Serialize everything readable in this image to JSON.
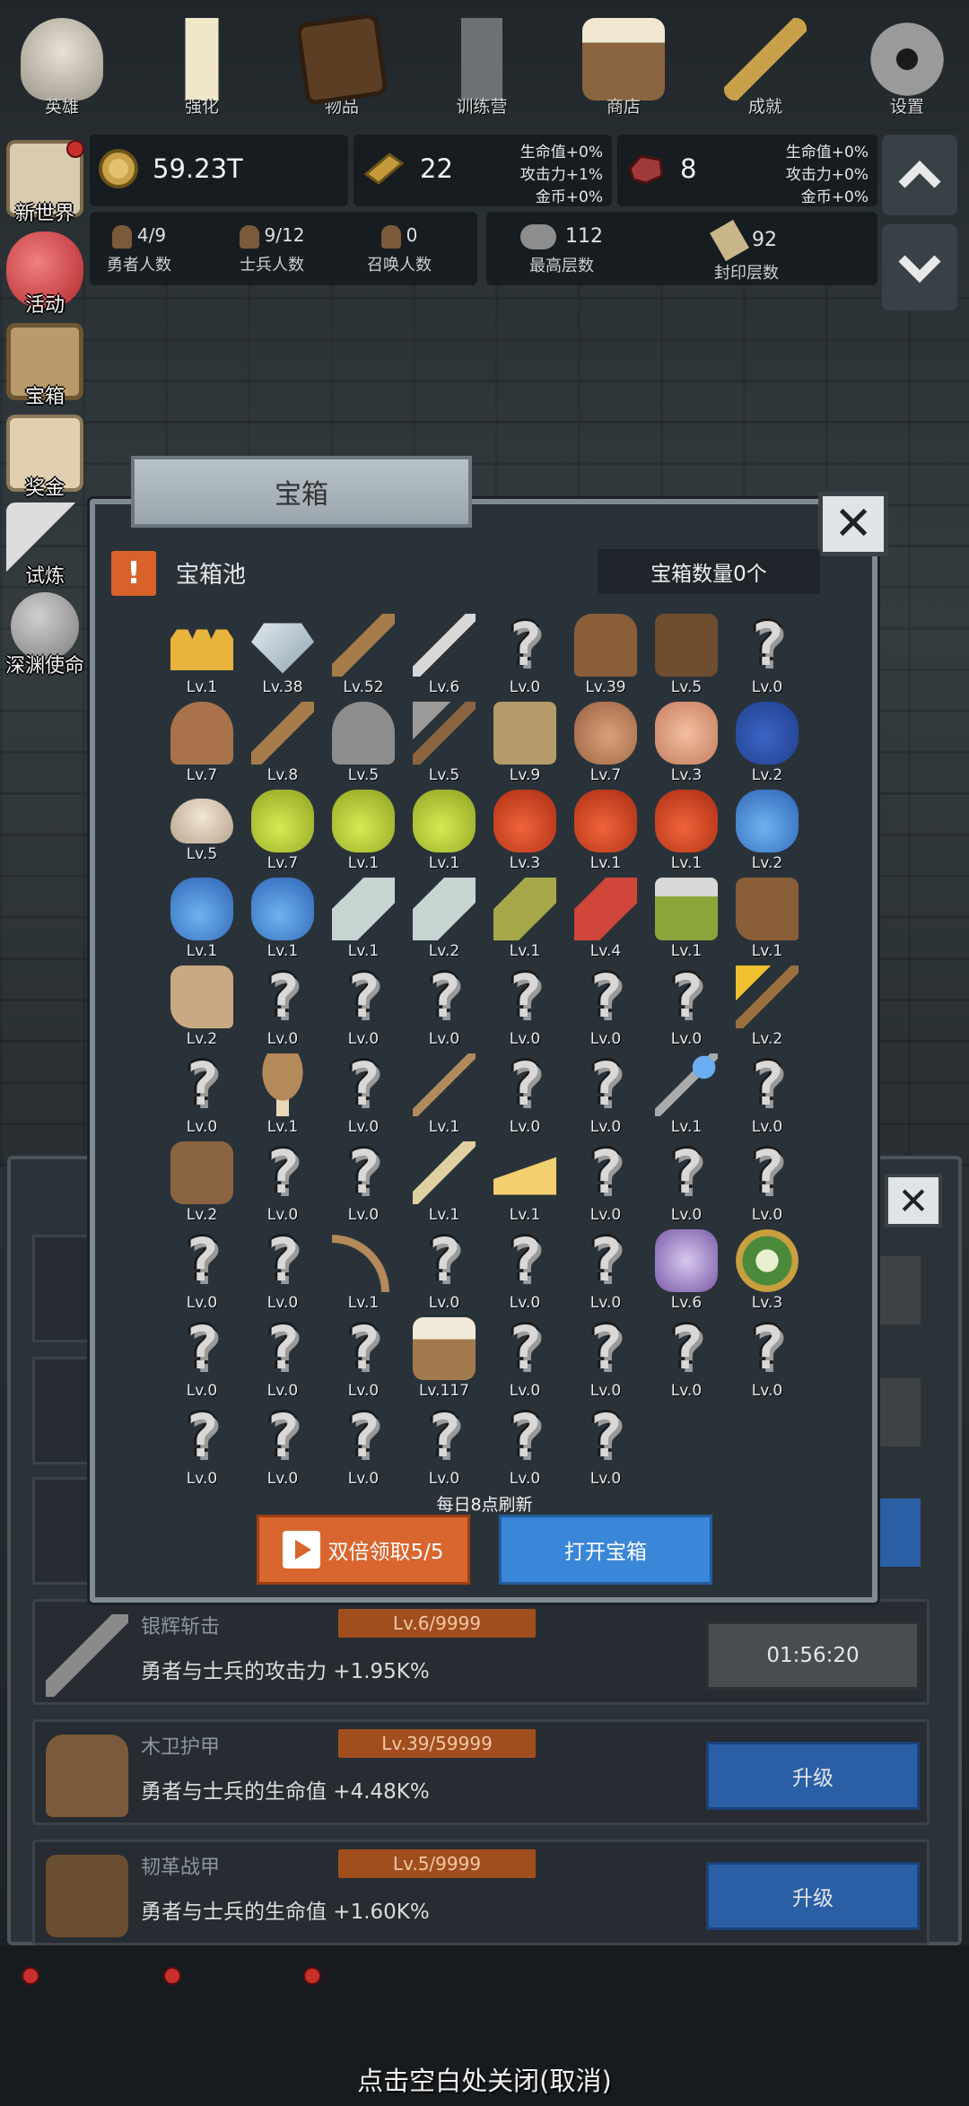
{
  "top": {
    "gold": {
      "value": "59.23T"
    },
    "bars": {
      "value": "22",
      "bonus": [
        "生命值+0%",
        "攻击力+1%",
        "金币+0%"
      ]
    },
    "meat": {
      "value": "8",
      "bonus": [
        "生命值+0%",
        "攻击力+0%",
        "金币+0%"
      ]
    },
    "stats": [
      {
        "value": "4/9",
        "label": "勇者人数"
      },
      {
        "value": "9/12",
        "label": "士兵人数"
      },
      {
        "value": "0",
        "label": "召唤人数"
      },
      {
        "value": "112",
        "label": "最高层数"
      },
      {
        "value": "92",
        "label": "封印层数"
      }
    ]
  },
  "side_menu": [
    {
      "label": "新世界",
      "icon": "map-icon"
    },
    {
      "label": "活动",
      "icon": "heart-icon"
    },
    {
      "label": "宝箱",
      "icon": "chest-icon"
    },
    {
      "label": "奖金",
      "icon": "envelope-icon"
    },
    {
      "label": "试炼",
      "icon": "quill-icon"
    },
    {
      "label": "深渊使命",
      "icon": "stone-icon"
    }
  ],
  "modal": {
    "tab_title": "宝箱",
    "pool_title": "宝箱池",
    "pool_icon": "!",
    "chest_count": "宝箱数量0个",
    "refresh_note": "每日8点刷新",
    "double_button": "双倍领取5/5",
    "open_button": "打开宝箱",
    "close_symbol": "✕",
    "items": [
      {
        "icon": "crown",
        "lv": "Lv.1"
      },
      {
        "icon": "diamond",
        "lv": "Lv.38"
      },
      {
        "icon": "sword",
        "lv": "Lv.52"
      },
      {
        "icon": "sword2",
        "lv": "Lv.6"
      },
      {
        "icon": "unknown",
        "lv": "Lv.0"
      },
      {
        "icon": "armor",
        "lv": "Lv.39"
      },
      {
        "icon": "vest",
        "lv": "Lv.5"
      },
      {
        "icon": "unknown",
        "lv": "Lv.0"
      },
      {
        "icon": "helmet",
        "lv": "Lv.7"
      },
      {
        "icon": "sword",
        "lv": "Lv.8"
      },
      {
        "icon": "knight-helm",
        "lv": "Lv.5"
      },
      {
        "icon": "hammer",
        "lv": "Lv.5"
      },
      {
        "icon": "great-helm",
        "lv": "Lv.9"
      },
      {
        "icon": "ham",
        "lv": "Lv.7"
      },
      {
        "icon": "steak",
        "lv": "Lv.3"
      },
      {
        "icon": "bag",
        "lv": "Lv.2"
      },
      {
        "icon": "bread",
        "lv": "Lv.5"
      },
      {
        "icon": "potion-yellow",
        "lv": "Lv.7"
      },
      {
        "icon": "potion-yellow",
        "lv": "Lv.1"
      },
      {
        "icon": "potion-yellow",
        "lv": "Lv.1"
      },
      {
        "icon": "potion-red",
        "lv": "Lv.3"
      },
      {
        "icon": "potion-red",
        "lv": "Lv.1"
      },
      {
        "icon": "potion-red",
        "lv": "Lv.1"
      },
      {
        "icon": "potion-blue",
        "lv": "Lv.2"
      },
      {
        "icon": "potion-blue",
        "lv": "Lv.1"
      },
      {
        "icon": "potion-blue",
        "lv": "Lv.1"
      },
      {
        "icon": "bottle-gray",
        "lv": "Lv.1"
      },
      {
        "icon": "bottle-gray",
        "lv": "Lv.2"
      },
      {
        "icon": "bottle-green",
        "lv": "Lv.1"
      },
      {
        "icon": "bottle-red",
        "lv": "Lv.4"
      },
      {
        "icon": "winged-boot",
        "lv": "Lv.1"
      },
      {
        "icon": "boot",
        "lv": "Lv.1"
      },
      {
        "icon": "shoe",
        "lv": "Lv.2"
      },
      {
        "icon": "unknown",
        "lv": "Lv.0"
      },
      {
        "icon": "unknown",
        "lv": "Lv.0"
      },
      {
        "icon": "unknown",
        "lv": "Lv.0"
      },
      {
        "icon": "unknown",
        "lv": "Lv.0"
      },
      {
        "icon": "unknown",
        "lv": "Lv.0"
      },
      {
        "icon": "unknown",
        "lv": "Lv.0"
      },
      {
        "icon": "torch",
        "lv": "Lv.2"
      },
      {
        "icon": "unknown",
        "lv": "Lv.0"
      },
      {
        "icon": "mushroom",
        "lv": "Lv.1"
      },
      {
        "icon": "unknown",
        "lv": "Lv.0"
      },
      {
        "icon": "staff",
        "lv": "Lv.1"
      },
      {
        "icon": "unknown",
        "lv": "Lv.0"
      },
      {
        "icon": "unknown",
        "lv": "Lv.0"
      },
      {
        "icon": "wand",
        "lv": "Lv.1"
      },
      {
        "icon": "unknown",
        "lv": "Lv.0"
      },
      {
        "icon": "backpack",
        "lv": "Lv.2"
      },
      {
        "icon": "unknown",
        "lv": "Lv.0"
      },
      {
        "icon": "unknown",
        "lv": "Lv.0"
      },
      {
        "icon": "spear",
        "lv": "Lv.1"
      },
      {
        "icon": "cheese",
        "lv": "Lv.1"
      },
      {
        "icon": "unknown",
        "lv": "Lv.0"
      },
      {
        "icon": "unknown",
        "lv": "Lv.0"
      },
      {
        "icon": "unknown",
        "lv": "Lv.0"
      },
      {
        "icon": "unknown",
        "lv": "Lv.0"
      },
      {
        "icon": "unknown",
        "lv": "Lv.0"
      },
      {
        "icon": "bow",
        "lv": "Lv.1"
      },
      {
        "icon": "unknown",
        "lv": "Lv.0"
      },
      {
        "icon": "unknown",
        "lv": "Lv.0"
      },
      {
        "icon": "unknown",
        "lv": "Lv.0"
      },
      {
        "icon": "scroll-purple",
        "lv": "Lv.6"
      },
      {
        "icon": "amulet",
        "lv": "Lv.3"
      },
      {
        "icon": "unknown",
        "lv": "Lv.0"
      },
      {
        "icon": "unknown",
        "lv": "Lv.0"
      },
      {
        "icon": "unknown",
        "lv": "Lv.0"
      },
      {
        "icon": "beer",
        "lv": "Lv.117"
      },
      {
        "icon": "unknown",
        "lv": "Lv.0"
      },
      {
        "icon": "unknown",
        "lv": "Lv.0"
      },
      {
        "icon": "unknown",
        "lv": "Lv.0"
      },
      {
        "icon": "unknown",
        "lv": "Lv.0"
      },
      {
        "icon": "unknown",
        "lv": "Lv.0"
      },
      {
        "icon": "unknown",
        "lv": "Lv.0"
      },
      {
        "icon": "unknown",
        "lv": "Lv.0"
      },
      {
        "icon": "unknown",
        "lv": "Lv.0"
      },
      {
        "icon": "unknown",
        "lv": "Lv.0"
      },
      {
        "icon": "unknown",
        "lv": "Lv.0"
      }
    ]
  },
  "list": [
    {
      "title": "银辉斩击",
      "lv": "Lv.6/9999",
      "desc": "勇者与士兵的攻击力 +1.95K%",
      "button": "01:56:20",
      "icon": "sword-icon"
    },
    {
      "title": "木卫护甲",
      "lv": "Lv.39/59999",
      "desc": "勇者与士兵的生命值 +4.48K%",
      "button": "升级",
      "icon": "armor-icon"
    },
    {
      "title": "韧革战甲",
      "lv": "Lv.5/9999",
      "desc": "勇者与士兵的生命值 +1.60K%",
      "button": "升级",
      "icon": "vest-icon"
    }
  ],
  "nav": [
    {
      "label": "英雄",
      "icon": "skull-icon"
    },
    {
      "label": "强化",
      "icon": "candle-icon"
    },
    {
      "label": "物品",
      "icon": "book-icon"
    },
    {
      "label": "训练营",
      "icon": "lantern-icon"
    },
    {
      "label": "商店",
      "icon": "mug-icon"
    },
    {
      "label": "成就",
      "icon": "key-icon"
    },
    {
      "label": "设置",
      "icon": "gear-icon"
    }
  ],
  "close_hint": "点击空白处关闭(取消)",
  "colors": {
    "orange": "#d8662e",
    "blue": "#3a86d8",
    "panel": "#2a3239",
    "level_bar": "#a14e1f"
  }
}
